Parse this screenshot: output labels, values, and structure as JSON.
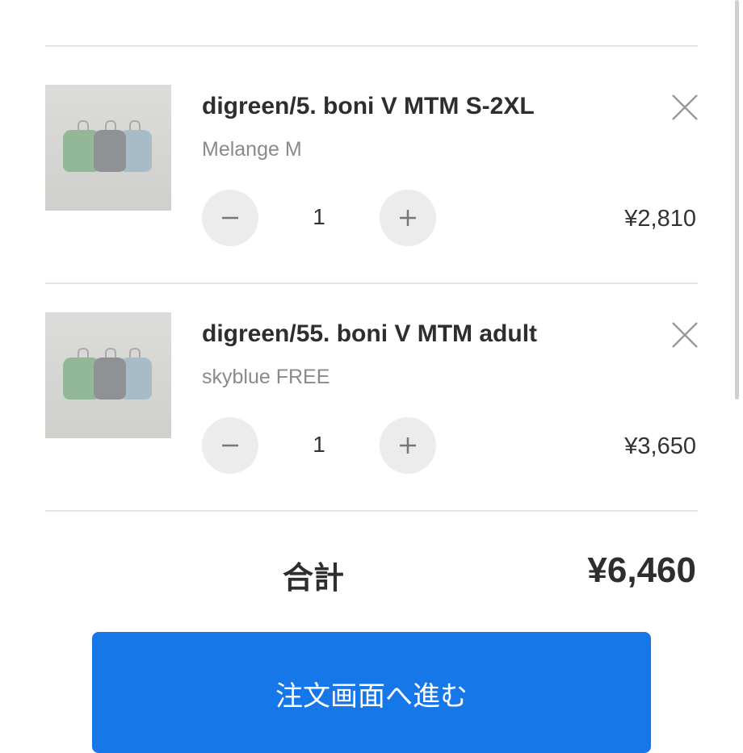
{
  "cart": {
    "items": [
      {
        "title": "digreen/5. boni V MTM S-2XL",
        "variant": "Melange M",
        "quantity": "1",
        "price": "¥2,810",
        "thumbnail": "product-photo"
      },
      {
        "title": "digreen/55. boni V MTM adult",
        "variant": "skyblue FREE",
        "quantity": "1",
        "price": "¥3,650",
        "thumbnail": "product-photo"
      }
    ],
    "icons": {
      "remove": "close-icon",
      "decrease": "minus-icon",
      "increase": "plus-icon"
    }
  },
  "summary": {
    "total_label": "合計",
    "total_value": "¥6,460"
  },
  "checkout": {
    "label": "注文画面へ進む"
  },
  "colors": {
    "accent": "#1677e8",
    "stepper_bg": "#ececec",
    "muted_text": "#8a8a8a"
  }
}
